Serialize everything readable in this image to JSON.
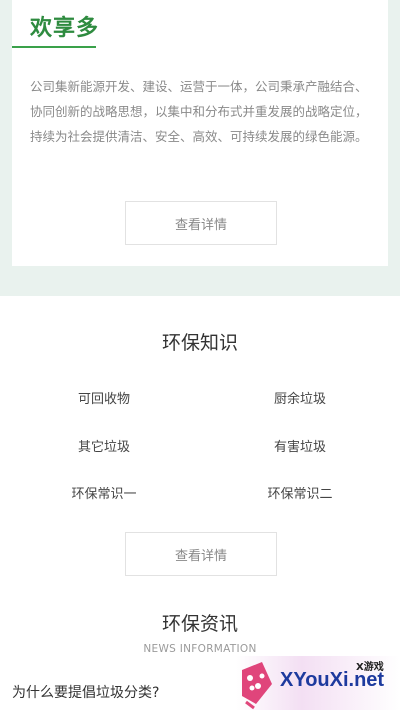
{
  "about": {
    "brand": "欢享多",
    "paragraph": "公司集新能源开发、建设、运营于一体，公司秉承产融结合、协同创新的战略思想，以集中和分布式并重发展的战略定位，持续为社会提供清洁、安全、高效、可持续发展的绿色能源。",
    "button_label": "查看详情"
  },
  "knowledge": {
    "title": "环保知识",
    "items": [
      "可回收物",
      "厨余垃圾",
      "其它垃圾",
      "有害垃圾",
      "环保常识一",
      "环保常识二"
    ],
    "button_label": "查看详情"
  },
  "news": {
    "title": "环保资讯",
    "subtitle": "NEWS INFORMATION",
    "items": [
      "为什么要提倡垃圾分类?"
    ]
  },
  "watermark": {
    "small": "X游戏",
    "big": "XYouXi.net",
    "colors": {
      "logo": "#e0457b",
      "text": "#1d3a9e"
    }
  }
}
